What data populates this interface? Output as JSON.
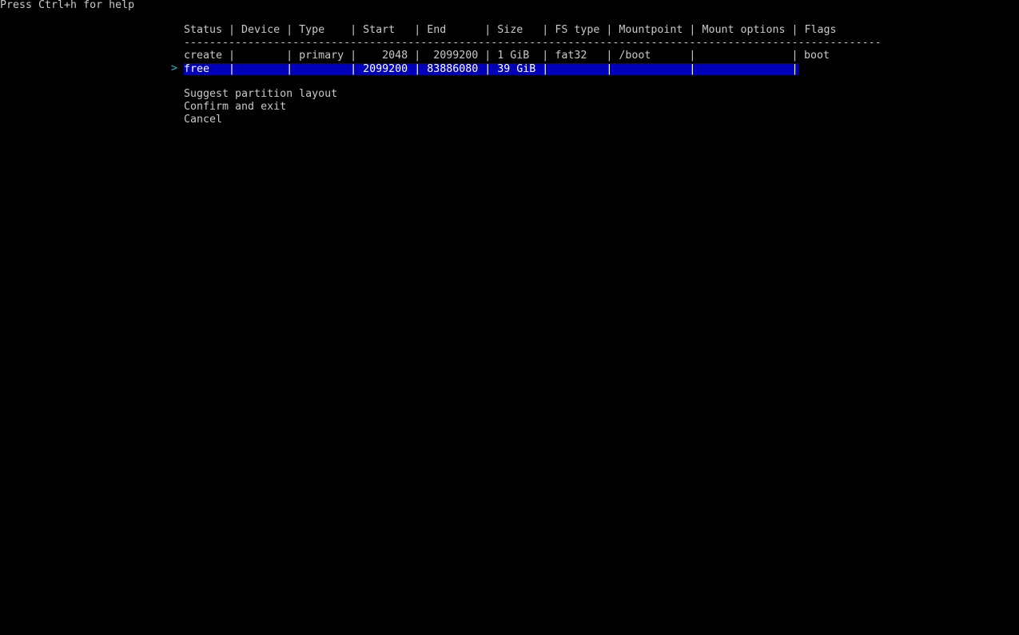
{
  "help_text": "Press Ctrl+h for help",
  "table": {
    "header": "Status | Device | Type    | Start   | End      | Size   | FS type | Mountpoint | Mount options | Flags",
    "rule": "-------------------------------------------------------------------------------------------------------------",
    "rows": [
      {
        "status": "create",
        "device": "",
        "type": "primary",
        "start": "2048",
        "end": "2099200",
        "size": "1 GiB",
        "fs_type": "fat32",
        "mountpoint": "/boot",
        "mount_options": "",
        "flags": "boot",
        "line": "create |        | primary |    2048 |  2099200 | 1 GiB  | fat32   | /boot      |               |"
      },
      {
        "status": "free",
        "device": "",
        "type": "",
        "start": "2099200",
        "end": "83886080",
        "size": "39 GiB",
        "fs_type": "",
        "mountpoint": "",
        "mount_options": "",
        "flags": "",
        "selected": true,
        "line": "free   |        |         | 2099200 | 83886080 | 39 GiB |         |            |               |"
      }
    ]
  },
  "cursor": ">",
  "menu": {
    "suggest": "Suggest partition layout",
    "confirm": "Confirm and exit",
    "cancel": "Cancel"
  },
  "colors": {
    "background": "#000000",
    "text": "#c8c8c8",
    "selection": "#0000b8",
    "cursor": "#22b8c8"
  }
}
